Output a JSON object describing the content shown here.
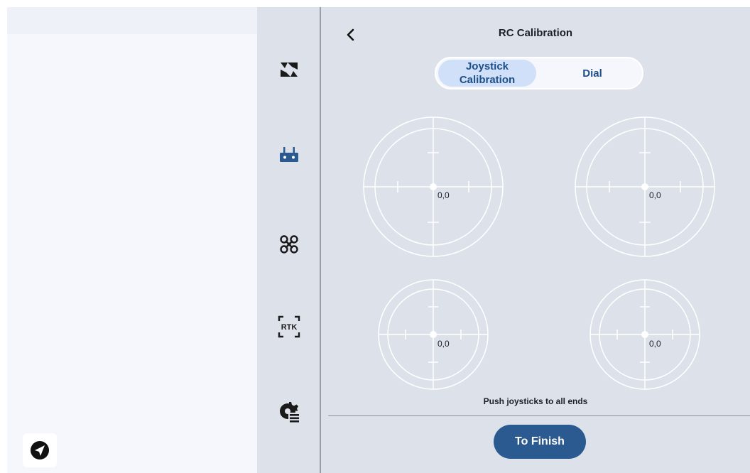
{
  "header": {
    "title": "RC Calibration"
  },
  "segmented": {
    "joystick_label": "Joystick Calibration",
    "dial_label": "Dial"
  },
  "sticks": [
    {
      "value": "0,0"
    },
    {
      "value": "0,0"
    },
    {
      "value": "0,0"
    },
    {
      "value": "0,0"
    }
  ],
  "hint": "Push joysticks to all ends",
  "finish_label": "To Finish",
  "nav": {
    "items": [
      {
        "icon": "camera-switch-icon"
      },
      {
        "icon": "remote-controller-icon"
      },
      {
        "icon": "drone-icon"
      },
      {
        "icon": "rtk-icon",
        "label": "RTK"
      },
      {
        "icon": "settings-list-icon"
      }
    ]
  },
  "colors": {
    "accent": "#2b5a90",
    "segment_active": "#cfe0f8",
    "background": "#dde2ea",
    "nav_icon": "#2b5a90"
  }
}
